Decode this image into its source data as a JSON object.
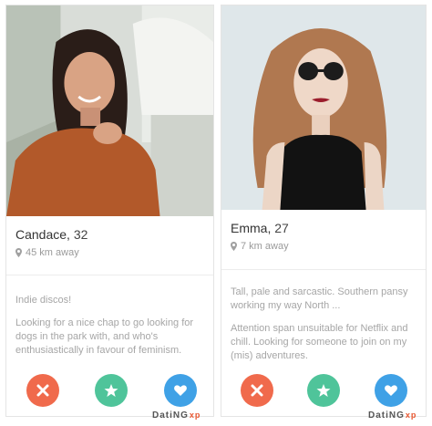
{
  "profiles": [
    {
      "name": "Candace,",
      "age": "32",
      "distance": "45 km away",
      "bio": [
        "Indie discos!",
        "Looking for a nice chap to go looking for dogs in the park with, and who's enthusiastically in favour of feminism."
      ]
    },
    {
      "name": "Emma,",
      "age": "27",
      "distance": "7 km away",
      "bio": [
        "Tall, pale and sarcastic. Southern pansy working my way North ...",
        "Attention span unsuitable for Netflix and chill. Looking for someone to join on my (mis) adventures."
      ]
    }
  ],
  "watermark": {
    "main": "DatiNG",
    "suffix": "xp"
  },
  "icons": [
    "location-pin-icon",
    "close-icon",
    "star-icon",
    "heart-icon"
  ],
  "colors": {
    "nope": "#f06a4c",
    "superlike": "#4fc49a",
    "like": "#3fa1e6"
  }
}
